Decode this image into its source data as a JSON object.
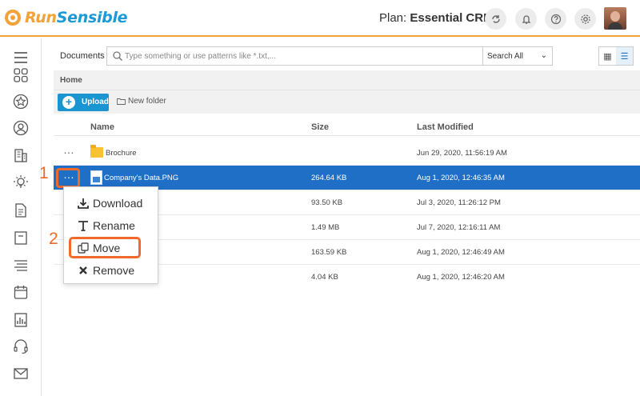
{
  "brand": {
    "name_part1": "Run",
    "name_part2": "Sensible",
    "accent_orange": "#f3a23a",
    "accent_blue": "#1c9ad6"
  },
  "header": {
    "plan_label": "Plan:",
    "plan_value": "Essential CRM",
    "icons": [
      "sync-icon",
      "notification-bell-icon",
      "help-icon",
      "settings-gear-icon"
    ],
    "avatar": "user-avatar"
  },
  "sidebar": {
    "icons": [
      "hamburger-menu-icon",
      "dashboard-icon",
      "star-icon",
      "contacts-icon",
      "companies-icon",
      "ideas-lightbulb-icon",
      "documents-icon",
      "archive-icon",
      "list-icon",
      "calendar-icon",
      "reports-icon",
      "support-headset-icon",
      "mail-icon"
    ]
  },
  "search": {
    "section_label": "Documents",
    "placeholder": "Type something or use patterns like *.txt,...",
    "scope": "Search All"
  },
  "breadcrumb": {
    "home": "Home"
  },
  "actions": {
    "upload": "Upload",
    "new_folder": "New folder"
  },
  "table": {
    "headers": {
      "name": "Name",
      "size": "Size",
      "modified": "Last Modified"
    },
    "rows": [
      {
        "name": "Brochure",
        "size": "",
        "modified": "Jun 29, 2020, 11:56:19 AM",
        "type": "folder",
        "selected": false
      },
      {
        "name": "Company's Data.PNG",
        "size": "264.64 KB",
        "modified": "Aug 1, 2020, 12:46:35 AM",
        "type": "image",
        "selected": true
      },
      {
        "name": "",
        "size": "93.50 KB",
        "modified": "Jul 3, 2020, 11:26:12 PM",
        "type": "file",
        "selected": false
      },
      {
        "name": "",
        "size": "1.49 MB",
        "modified": "Jul 7, 2020, 12:16:11 AM",
        "type": "file",
        "selected": false
      },
      {
        "name": "",
        "size": "163.59 KB",
        "modified": "Aug 1, 2020, 12:46:49 AM",
        "type": "file",
        "selected": false
      },
      {
        "name": "",
        "size": "4.04 KB",
        "modified": "Aug 1, 2020, 12:46:20 AM",
        "type": "file",
        "selected": false
      }
    ]
  },
  "context_menu": {
    "download": "Download",
    "rename": "Rename",
    "move": "Move",
    "remove": "Remove"
  },
  "callouts": {
    "step1": "1",
    "step2": "2",
    "highlight_color": "#f06a2b"
  }
}
